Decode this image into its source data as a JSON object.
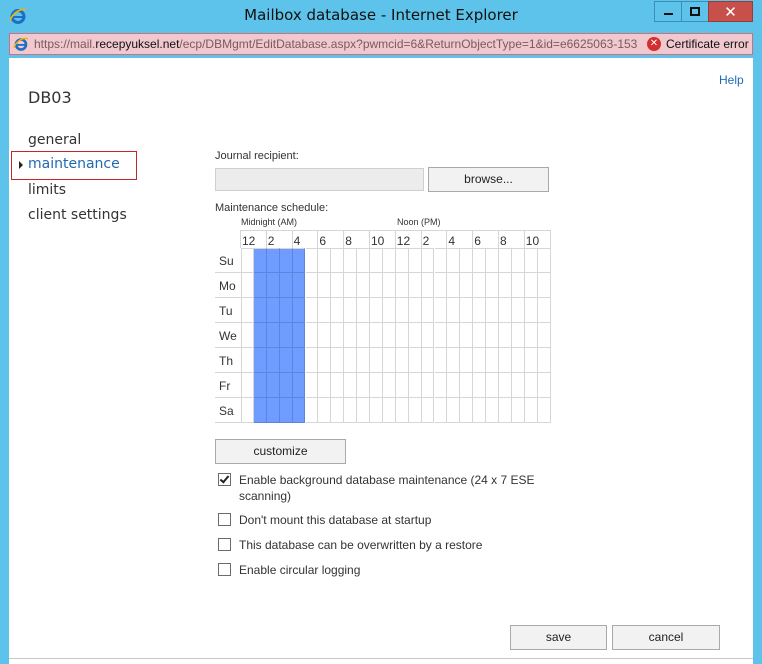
{
  "window": {
    "title": "Mailbox database - Internet Explorer",
    "close_glyph": "✕"
  },
  "address": {
    "url_prefix": "https://mail.",
    "url_domain": "recepyuksel.net",
    "url_path": "/ecp/DBMgmt/EditDatabase.aspx?pwmcid=6&ReturnObjectType=1&id=e6625063-153",
    "cert_icon_glyph": "✕",
    "cert_error": "Certificate error"
  },
  "help": "Help",
  "db_name": "DB03",
  "nav": {
    "items": [
      "general",
      "maintenance",
      "limits",
      "client settings"
    ],
    "selected_index": 1
  },
  "journal": {
    "label": "Journal recipient:",
    "value": "",
    "browse_label": "browse..."
  },
  "schedule": {
    "label": "Maintenance schedule:",
    "midnight_label": "Midnight (AM)",
    "noon_label": "Noon (PM)",
    "hours": [
      "12",
      "2",
      "4",
      "6",
      "8",
      "10",
      "12",
      "2",
      "4",
      "6",
      "8",
      "10"
    ],
    "days": [
      "Su",
      "Mo",
      "Tu",
      "We",
      "Th",
      "Fr",
      "Sa"
    ],
    "selected_hours": [
      1,
      2,
      3,
      4
    ],
    "selected_color": "#6f9cff",
    "customize_label": "customize"
  },
  "options": [
    {
      "label": "Enable background database maintenance (24 x 7 ESE scanning)",
      "checked": true
    },
    {
      "label": "Don't mount this database at startup",
      "checked": false
    },
    {
      "label": "This database can be overwritten by a restore",
      "checked": false
    },
    {
      "label": "Enable circular logging",
      "checked": false
    }
  ],
  "footer": {
    "save_label": "save",
    "cancel_label": "cancel"
  }
}
